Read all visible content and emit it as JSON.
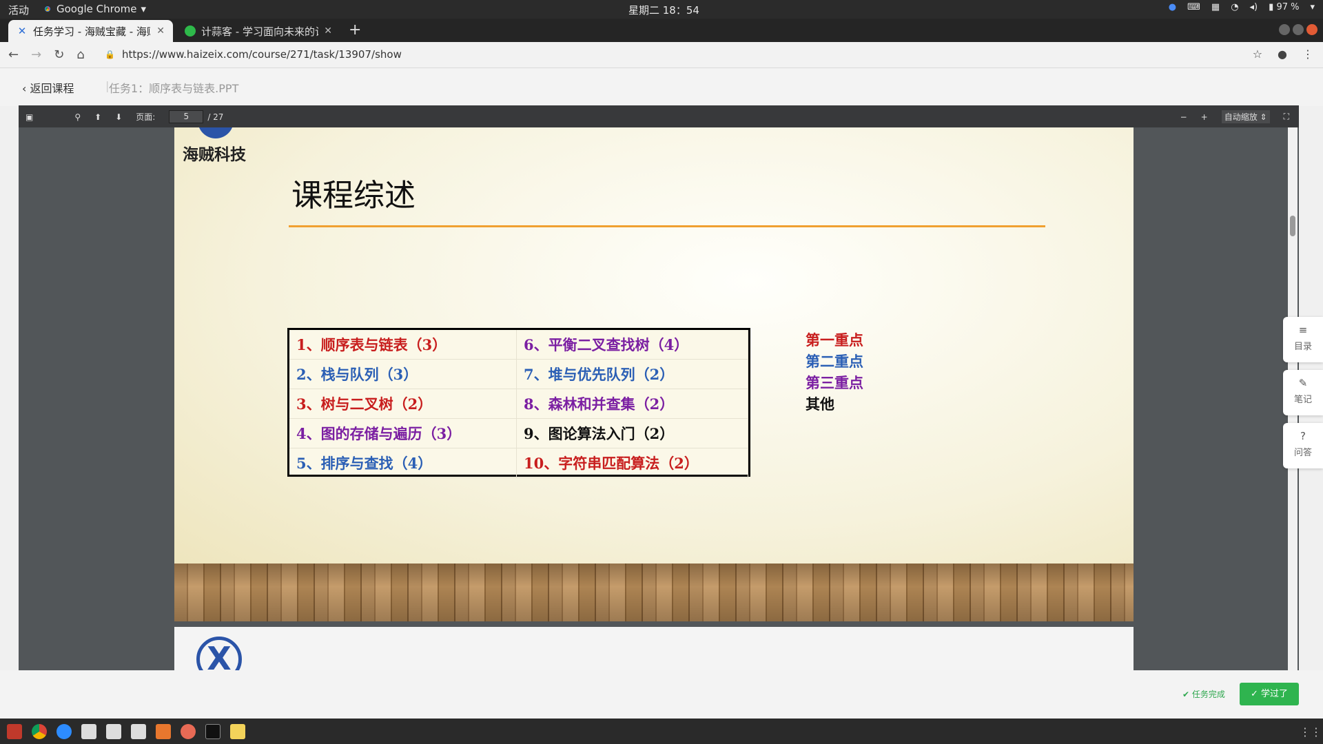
{
  "topbar": {
    "activities": "活动",
    "app_name": "Google Chrome",
    "clock": "星期二 18：54",
    "battery": "97 %"
  },
  "tabs": [
    {
      "title": "任务学习 - 海贼宝藏 - 海贼"
    },
    {
      "title": "计蒜客 - 学习面向未来的计"
    }
  ],
  "address": {
    "url": "https://www.haizeix.com/course/271/task/13907/show"
  },
  "pagebar": {
    "back": "返回课程",
    "task_title": "任务1：顺序表与链表.PPT"
  },
  "pdf": {
    "page_label": "页面:",
    "page_value": "5",
    "page_total": "/ 27",
    "zoom": "自动缩放"
  },
  "slide": {
    "brand": "海贼科技",
    "title": "课程综述",
    "table": [
      {
        "text": "1、顺序表与链表（3）",
        "color": "red"
      },
      {
        "text": "6、平衡二叉查找树（4）",
        "color": "purple"
      },
      {
        "text": "2、栈与队列（3）",
        "color": "blue"
      },
      {
        "text": "7、堆与优先队列（2）",
        "color": "blue"
      },
      {
        "text": "3、树与二叉树（2）",
        "color": "red"
      },
      {
        "text": "8、森林和并查集（2）",
        "color": "purple"
      },
      {
        "text": "4、图的存储与遍历（3）",
        "color": "purple"
      },
      {
        "text": "9、图论算法入门（2）",
        "color": "black"
      },
      {
        "text": "5、排序与查找（4）",
        "color": "blue"
      },
      {
        "text": "10、字符串匹配算法（2）",
        "color": "red"
      }
    ],
    "legend": [
      {
        "text": "第一重点",
        "color": "red"
      },
      {
        "text": "第二重点",
        "color": "blue"
      },
      {
        "text": "第三重点",
        "color": "purple"
      },
      {
        "text": "其他",
        "color": "black"
      }
    ]
  },
  "side": {
    "toc": "目录",
    "notes": "笔记",
    "qa": "问答"
  },
  "bottom": {
    "task_done": "任务完成",
    "learned": "学过了"
  },
  "colors": {
    "accent_green": "#2fb44f",
    "title_rule": "#f0a030"
  }
}
